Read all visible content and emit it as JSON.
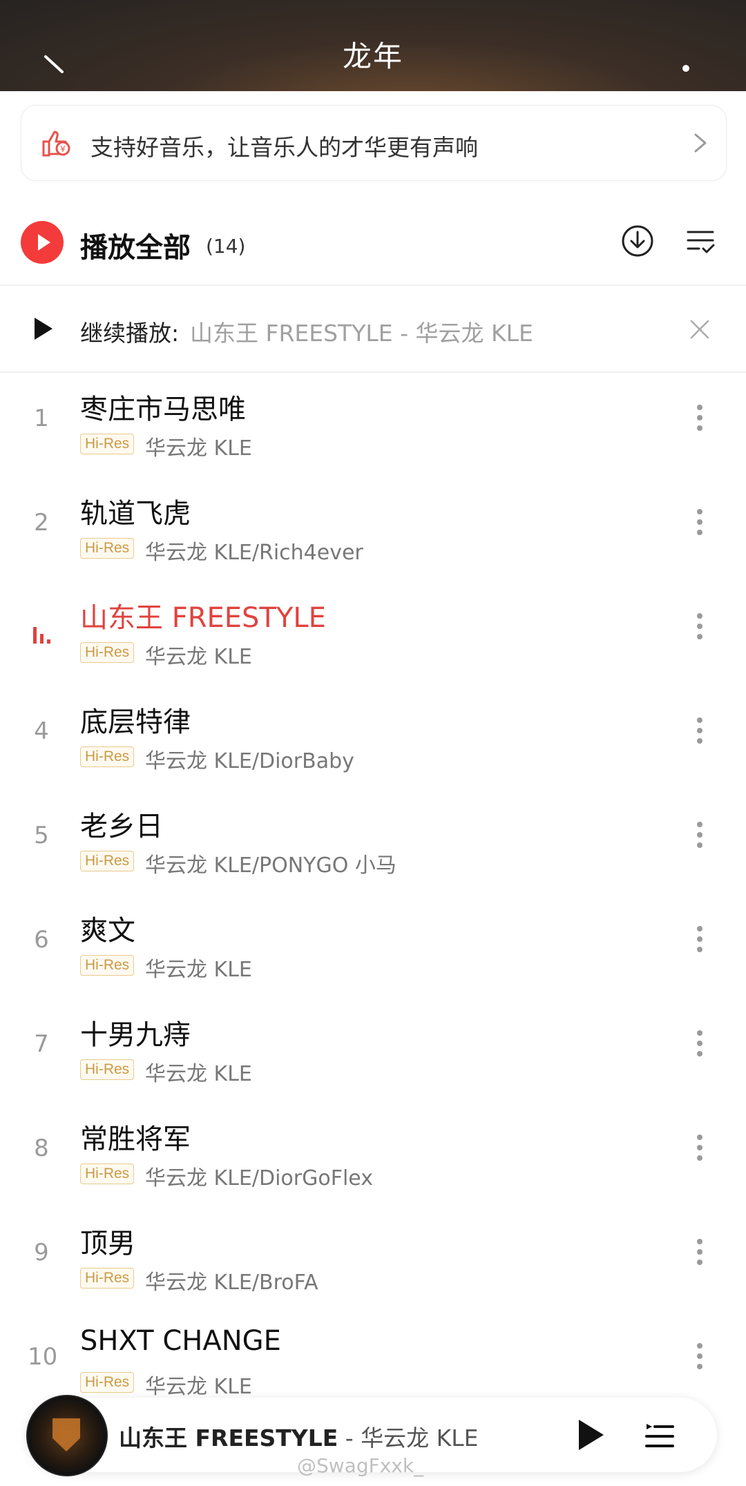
{
  "header": {
    "title": "龙年"
  },
  "banner": {
    "text": "支持好音乐，让音乐人的才华更有声响"
  },
  "play_all": {
    "label": "播放全部",
    "count": "(14)"
  },
  "continue": {
    "label": "继续播放:",
    "song": "山东王 FREESTYLE - 华云龙 KLE"
  },
  "tracks": [
    {
      "num": "1",
      "title": "枣庄市马思唯",
      "badge": "Hi-Res",
      "artist": "华云龙 KLE"
    },
    {
      "num": "2",
      "title": "轨道飞虎",
      "badge": "Hi-Res",
      "artist": "华云龙 KLE/Rich4ever"
    },
    {
      "num": "",
      "title": "山东王 FREESTYLE",
      "badge": "Hi-Res",
      "artist": "华云龙 KLE"
    },
    {
      "num": "4",
      "title": "底层特律",
      "badge": "Hi-Res",
      "artist": "华云龙 KLE/DiorBaby"
    },
    {
      "num": "5",
      "title": "老乡日",
      "badge": "Hi-Res",
      "artist": "华云龙 KLE/PONYGO 小马"
    },
    {
      "num": "6",
      "title": "爽文",
      "badge": "Hi-Res",
      "artist": "华云龙 KLE"
    },
    {
      "num": "7",
      "title": "十男九痔",
      "badge": "Hi-Res",
      "artist": "华云龙 KLE"
    },
    {
      "num": "8",
      "title": "常胜将军",
      "badge": "Hi-Res",
      "artist": "华云龙 KLE/DiorGoFlex"
    },
    {
      "num": "9",
      "title": "顶男",
      "badge": "Hi-Res",
      "artist": "华云龙 KLE/BroFA"
    },
    {
      "num": "10",
      "title": "SHXT CHANGE",
      "badge": "Hi-Res",
      "artist": "华云龙 KLE"
    }
  ],
  "mini_player": {
    "title": "山东王 FREESTYLE",
    "artist": " - 华云龙 KLE"
  },
  "watermark": "@SwagFxxk_",
  "colors": {
    "accent": "#f43b3b",
    "playing": "#e0433f",
    "hires": "#c99a45"
  }
}
